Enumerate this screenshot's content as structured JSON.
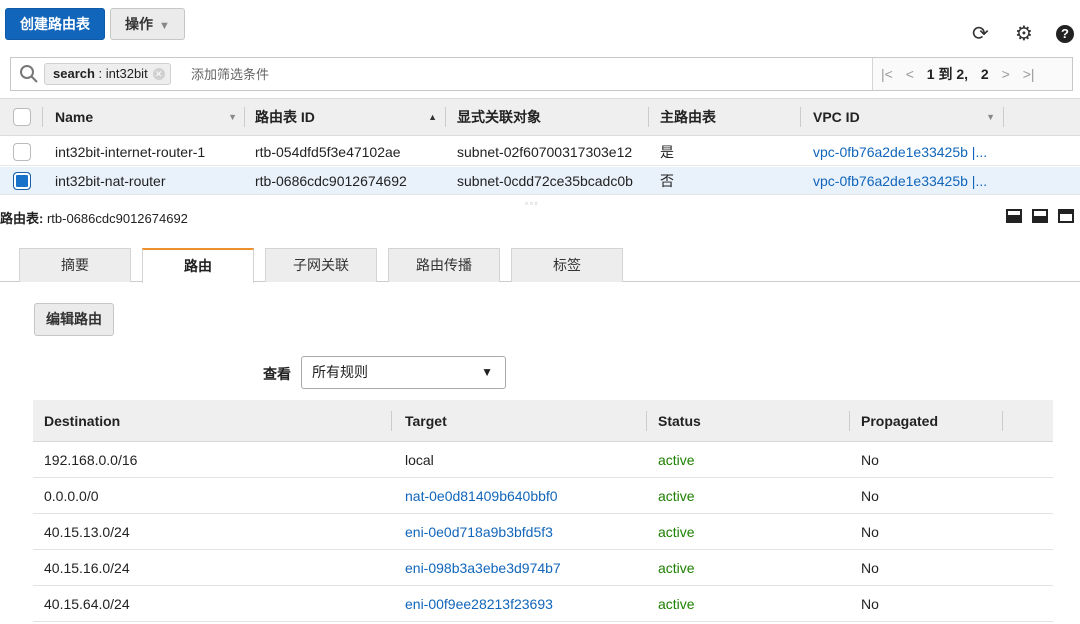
{
  "toolbar": {
    "create_label": "创建路由表",
    "actions_label": "操作",
    "refresh_icon": "⟳",
    "settings_icon": "⚙",
    "help_icon": "?"
  },
  "search": {
    "token_key": "search",
    "token_value": " : int32bit",
    "placeholder": "添加筛选条件"
  },
  "pager": {
    "first": "|<",
    "prev": "<",
    "current": "1 到 2,",
    "total": "2",
    "next": ">",
    "last": ">|"
  },
  "route_tables": {
    "columns": [
      "Name",
      "路由表 ID",
      "显式关联对象",
      "主路由表",
      "VPC ID"
    ],
    "rows": [
      {
        "name": "int32bit-internet-router-1",
        "id": "rtb-054dfd5f3e47102ae",
        "assoc": "subnet-02f60700317303e12",
        "main": "是",
        "vpc": "vpc-0fb76a2de1e33425b |...",
        "selected": false
      },
      {
        "name": "int32bit-nat-router",
        "id": "rtb-0686cdc9012674692",
        "assoc": "subnet-0cdd72ce35bcadc0b",
        "main": "否",
        "vpc": "vpc-0fb76a2de1e33425b |...",
        "selected": true
      }
    ]
  },
  "detail": {
    "title_label": "路由表:",
    "title_value": " rtb-0686cdc9012674692",
    "tabs": [
      "摘要",
      "路由",
      "子网关联",
      "路由传播",
      "标签"
    ],
    "active_tab": "路由",
    "edit_routes_label": "编辑路由",
    "view_label": "查看",
    "view_selected": "所有规则"
  },
  "routes": {
    "columns": [
      "Destination",
      "Target",
      "Status",
      "Propagated"
    ],
    "rows": [
      {
        "destination": "192.168.0.0/16",
        "target": "local",
        "status": "active",
        "propagated": "No",
        "target_link": false
      },
      {
        "destination": "0.0.0.0/0",
        "target": "nat-0e0d81409b640bbf0",
        "status": "active",
        "propagated": "No",
        "target_link": true
      },
      {
        "destination": "40.15.13.0/24",
        "target": "eni-0e0d718a9b3bfd5f3",
        "status": "active",
        "propagated": "No",
        "target_link": true
      },
      {
        "destination": "40.15.16.0/24",
        "target": "eni-098b3a3ebe3d974b7",
        "status": "active",
        "propagated": "No",
        "target_link": true
      },
      {
        "destination": "40.15.64.0/24",
        "target": "eni-00f9ee28213f23693",
        "status": "active",
        "propagated": "No",
        "target_link": true
      }
    ]
  },
  "colors": {
    "primary": "#1166bb",
    "link": "#1166bb",
    "active_status": "#1d8102",
    "tab_accent": "#ec912d"
  }
}
